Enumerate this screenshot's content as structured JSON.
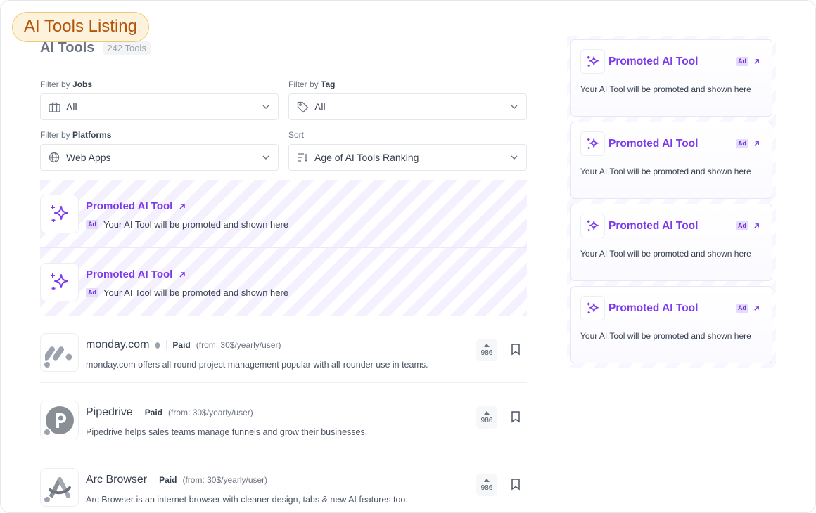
{
  "badge": {
    "label": "AI Tools Listing"
  },
  "header": {
    "title": "AI Tools",
    "count": "242 Tools"
  },
  "filters": {
    "jobs": {
      "prefix": "Filter by ",
      "name": "Jobs",
      "value": "All",
      "icon": "briefcase-icon"
    },
    "tag": {
      "prefix": "Filter by ",
      "name": "Tag",
      "value": "All",
      "icon": "tag-icon"
    },
    "platforms": {
      "prefix": "Filter by ",
      "name": "Platforms",
      "value": "Web Apps",
      "icon": "globe-icon"
    },
    "sort": {
      "label": "Sort",
      "value": "Age of AI Tools Ranking",
      "icon": "sort-icon"
    }
  },
  "promos": [
    {
      "title": "Promoted AI Tool",
      "ad": "Ad",
      "desc": "Your AI Tool will be promoted and shown here"
    },
    {
      "title": "Promoted AI Tool",
      "ad": "Ad",
      "desc": "Your AI Tool will be promoted and shown here"
    }
  ],
  "tools": [
    {
      "name": "monday.com",
      "pricing": "Paid",
      "price": "(from: 30$/yearly/user)",
      "desc": "monday.com offers all-round project management popular with all-rounder use in teams.",
      "votes": "986"
    },
    {
      "name": "Pipedrive",
      "pricing": "Paid",
      "price": "(from: 30$/yearly/user)",
      "desc": "Pipedrive helps sales teams manage funnels and grow their businesses.",
      "votes": "986"
    },
    {
      "name": "Arc Browser",
      "pricing": "Paid",
      "price": "(from: 30$/yearly/user)",
      "desc": "Arc Browser is an internet browser with cleaner design, tabs & new AI features too.",
      "votes": "986"
    }
  ],
  "sidebar": {
    "cards": [
      {
        "title": "Promoted AI Tool",
        "ad": "Ad",
        "desc": "Your AI Tool will be promoted and shown here"
      },
      {
        "title": "Promoted AI Tool",
        "ad": "Ad",
        "desc": "Your AI Tool will be promoted and shown here"
      },
      {
        "title": "Promoted AI Tool",
        "ad": "Ad",
        "desc": "Your AI Tool will be promoted and shown here"
      },
      {
        "title": "Promoted AI Tool",
        "ad": "Ad",
        "desc": "Your AI Tool will be promoted and shown here"
      }
    ]
  },
  "colors": {
    "accent": "#7c3aed",
    "badge_bg": "#fdf3dd",
    "badge_border": "#f1c871",
    "badge_text": "#b4530a"
  }
}
